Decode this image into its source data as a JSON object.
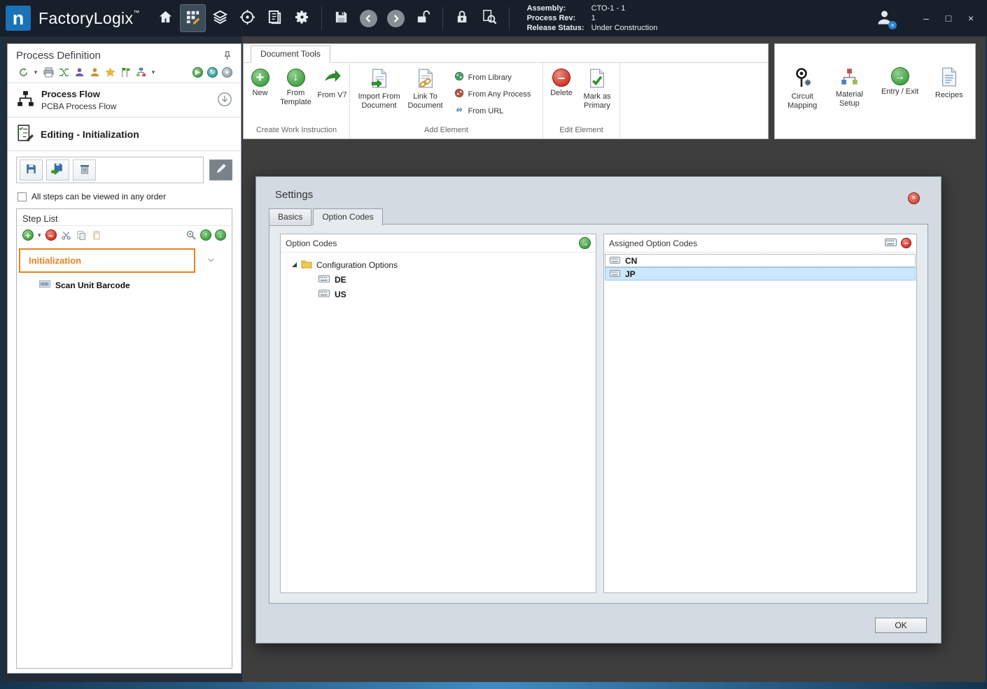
{
  "titlebar": {
    "logo_letter": "n",
    "app_name": "FactoryLogix",
    "trademark": "™",
    "assembly_label": "Assembly:",
    "assembly_value": "CTO-1 - 1",
    "process_rev_label": "Process Rev:",
    "process_rev_value": "1",
    "release_status_label": "Release Status:",
    "release_status_value": "Under Construction",
    "minimize_glyph": "–",
    "maximize_glyph": "□",
    "close_glyph": "×"
  },
  "sidebar": {
    "title": "Process Definition",
    "process_flow_title": "Process Flow",
    "process_flow_subtitle": "PCBA Process Flow",
    "editing_label": "Editing - Initialization",
    "order_checkbox_label": "All steps can be viewed in any order",
    "step_list_title": "Step List",
    "selected_step": "Initialization",
    "child_step": "Scan Unit Barcode"
  },
  "ribbon": {
    "tab_label": "Document Tools",
    "new_label": "New",
    "from_template_label": "From Template",
    "from_v7_label": "From V7",
    "group_create_label": "Create Work Instruction",
    "import_from_document_label": "Import From Document",
    "link_to_document_label": "Link To Document",
    "from_library_label": "From Library",
    "from_any_process_label": "From Any Process",
    "from_url_label": "From URL",
    "group_add_label": "Add Element",
    "delete_label": "Delete",
    "mark_as_primary_label": "Mark as Primary",
    "group_edit_label": "Edit Element",
    "circuit_mapping_label": "Circuit Mapping",
    "material_setup_label": "Material Setup",
    "entry_exit_label": "Entry / Exit",
    "recipes_label": "Recipes"
  },
  "dialog": {
    "title": "Settings",
    "close_glyph": "×",
    "tab_basics": "Basics",
    "tab_option_codes": "Option Codes",
    "left_panel_title": "Option Codes",
    "tree_root_label": "Configuration Options",
    "tree_items": [
      "DE",
      "US"
    ],
    "right_panel_title": "Assigned Option Codes",
    "assigned_items": [
      "CN",
      "JP"
    ],
    "ok_label": "OK"
  }
}
